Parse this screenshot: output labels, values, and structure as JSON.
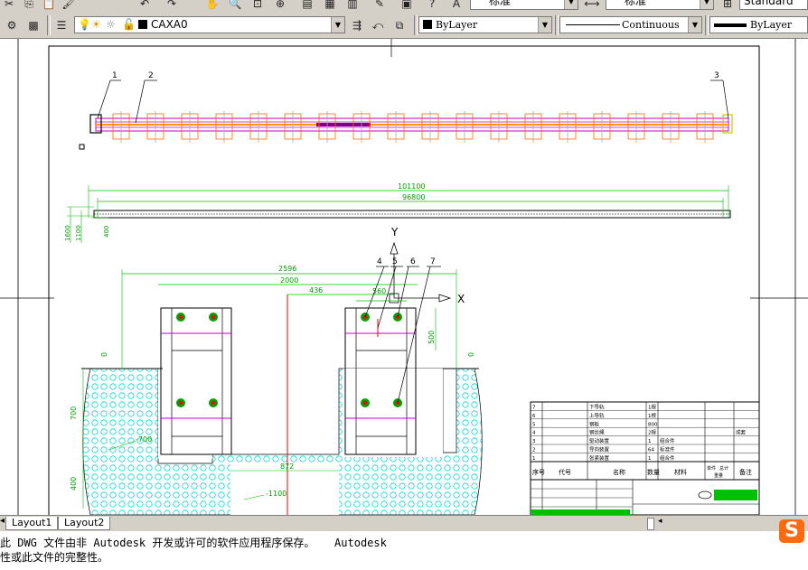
{
  "toolbar_top": {
    "text_style_value": "标准",
    "dim_style_value": "标准",
    "table_style_value": "Standard"
  },
  "layers_toolbar": {
    "current_layer": "CAXA0",
    "color_value": "ByLayer",
    "linetype_value": "Continuous",
    "lineweight_value": "ByLayer"
  },
  "drawing": {
    "top_callouts": [
      "1",
      "2",
      "3"
    ],
    "label_dims": {
      "overall_total": "101100",
      "overall_inner": "96800",
      "height_a": "1600",
      "height_b": "1100",
      "height_c": "400"
    },
    "section_dims": {
      "width_total": "2596",
      "width_2000": "2000",
      "offset_436": "436",
      "gap_560": "560",
      "height_500": "500",
      "height_700": "700",
      "height_400": "400",
      "depth_700": "-700",
      "depth_1100": "-1100",
      "center_872": "872",
      "left_0": "0",
      "right_0": "0"
    },
    "section_callouts": [
      "4",
      "5",
      "6",
      "7"
    ],
    "axis_y": "Y",
    "axis_x": "X",
    "title_block": {
      "rows": [
        {
          "no": "7",
          "name": "下导轨",
          "qty": "1根",
          "mat": ""
        },
        {
          "no": "6",
          "name": "上导轨",
          "qty": "1根",
          "mat": ""
        },
        {
          "no": "5",
          "name": "钢板",
          "qty": "800",
          "mat": ""
        },
        {
          "no": "4",
          "name": "钢丝绳",
          "qty": "2根",
          "mat": "",
          "extra": "成套"
        },
        {
          "no": "3",
          "name": "驱动装置",
          "qty": "1",
          "mat": "组合件"
        },
        {
          "no": "2",
          "name": "导向装置",
          "qty": "64",
          "mat": "标准件"
        },
        {
          "no": "1",
          "name": "张紧装置",
          "qty": "1",
          "mat": "组合件"
        }
      ],
      "header": {
        "no": "序号",
        "code": "代号",
        "name": "名称",
        "qty": "数量",
        "mat": "材料",
        "unit_weight": "单件",
        "total_weight": "总计",
        "weight": "重量",
        "note": "备注"
      }
    }
  },
  "layout_tabs": [
    "Layout1",
    "Layout2"
  ],
  "command_lines": [
    "此 DWG 文件由非 Autodesk 开发或许可的软件应用程序保存。   Autodesk",
    "性或此文件的完整性。"
  ],
  "logo_letter": "S"
}
